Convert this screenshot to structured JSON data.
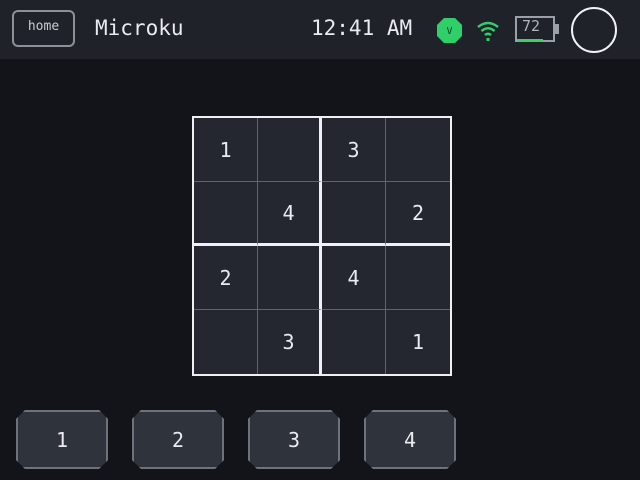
{
  "topbar": {
    "home_label": "home",
    "app_title": "Microku",
    "time": "12:41 AM",
    "vpn_icon": "vpn-shield-icon",
    "vpn_letter": "V",
    "wifi_icon": "wifi-icon",
    "battery_level": "72",
    "battery_icon": "battery-icon",
    "profile_icon": "profile-circle-icon",
    "colors": {
      "vpn": "#2fd069",
      "wifi": "#2fd069",
      "battery_fill": "#3fd06a"
    }
  },
  "board": {
    "size": 4,
    "cells": [
      [
        "1",
        "",
        "3",
        ""
      ],
      [
        "",
        "4",
        "",
        "2"
      ],
      [
        "2",
        "",
        "4",
        ""
      ],
      [
        "",
        "3",
        "",
        "1"
      ]
    ]
  },
  "numpad": {
    "keys": [
      "1",
      "2",
      "3",
      "4"
    ]
  }
}
